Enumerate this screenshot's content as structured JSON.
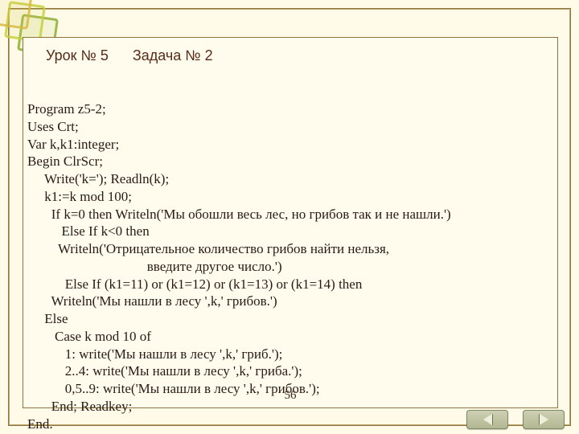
{
  "title": {
    "lesson": "Урок № 5",
    "task": "Задача № 2"
  },
  "code_lines": [
    "Program z5-2;",
    "Uses Crt;",
    "Var k,k1:integer;",
    "Begin ClrScr;",
    "     Write('k='); Readln(k);",
    "     k1:=k mod 100;",
    "       If k=0 then Writeln('Мы обошли весь лес, но грибов так и не нашли.')",
    "          Else If k<0 then",
    "         Writeln('Отрицательное количество грибов найти нельзя,",
    "                                   введите другое число.')",
    "           Else If (k1=11) or (k1=12) or (k1=13) or (k1=14) then",
    "       Writeln('Мы нашли в лесу ',k,' грибов.')",
    "     Else",
    "        Case k mod 10 of",
    "           1: write('Мы нашли в лесу ',k,' гриб.');",
    "           2..4: write('Мы нашли в лесу ',k,' гриба.');",
    "           0,5..9: write('Мы нашли в лесу ',k,' грибов.');",
    "       End; Readkey;",
    "End."
  ],
  "page_number": "56",
  "nav": {
    "prev_name": "previous-slide-button",
    "next_name": "next-slide-button"
  }
}
